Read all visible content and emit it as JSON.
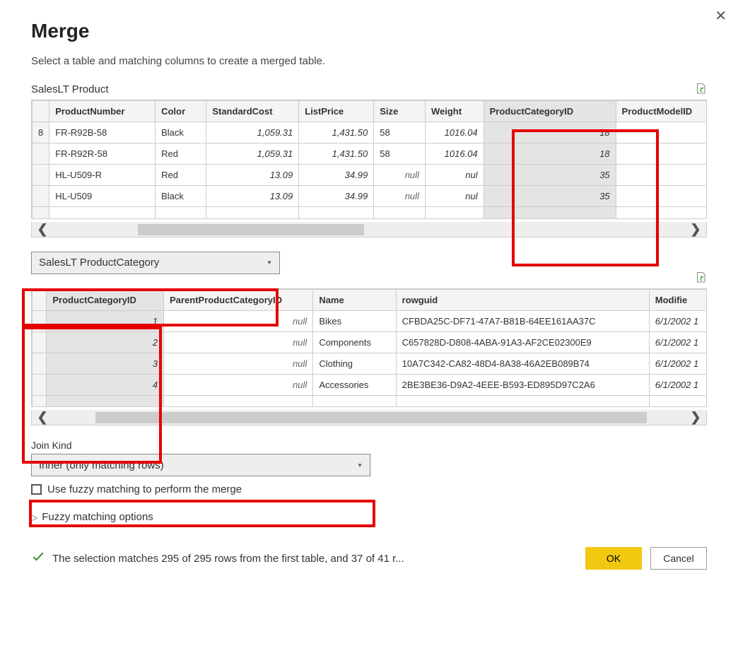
{
  "dialog": {
    "title": "Merge",
    "subtitle": "Select a table and matching columns to create a merged table."
  },
  "table1": {
    "name": "SalesLT Product",
    "columns": [
      "",
      "ProductNumber",
      "Color",
      "StandardCost",
      "ListPrice",
      "Size",
      "Weight",
      "ProductCategoryID",
      "ProductModelID"
    ],
    "rows": [
      {
        "idx": "8",
        "pn": "FR-R92B-58",
        "color": "Black",
        "sc": "1,059.31",
        "lp": "1,431.50",
        "size": "58",
        "w": "1016.04",
        "cat": "18",
        "pm": ""
      },
      {
        "idx": "",
        "pn": "FR-R92R-58",
        "color": "Red",
        "sc": "1,059.31",
        "lp": "1,431.50",
        "size": "58",
        "w": "1016.04",
        "cat": "18",
        "pm": ""
      },
      {
        "idx": "",
        "pn": "HL-U509-R",
        "color": "Red",
        "sc": "13.09",
        "lp": "34.99",
        "size": "null",
        "w": "nul",
        "cat": "35",
        "pm": ""
      },
      {
        "idx": "",
        "pn": "HL-U509",
        "color": "Black",
        "sc": "13.09",
        "lp": "34.99",
        "size": "null",
        "w": "nul",
        "cat": "35",
        "pm": ""
      }
    ]
  },
  "table2": {
    "selected": "SalesLT ProductCategory",
    "columns": [
      "",
      "ProductCategoryID",
      "ParentProductCategoryID",
      "Name",
      "rowguid",
      "Modifie"
    ],
    "rows": [
      {
        "idx": "",
        "id": "1",
        "parent": "null",
        "name": "Bikes",
        "guid": "CFBDA25C-DF71-47A7-B81B-64EE161AA37C",
        "mod": "6/1/2002 1"
      },
      {
        "idx": "",
        "id": "2",
        "parent": "null",
        "name": "Components",
        "guid": "C657828D-D808-4ABA-91A3-AF2CE02300E9",
        "mod": "6/1/2002 1"
      },
      {
        "idx": "",
        "id": "3",
        "parent": "null",
        "name": "Clothing",
        "guid": "10A7C342-CA82-48D4-8A38-46A2EB089B74",
        "mod": "6/1/2002 1"
      },
      {
        "idx": "",
        "id": "4",
        "parent": "null",
        "name": "Accessories",
        "guid": "2BE3BE36-D9A2-4EEE-B593-ED895D97C2A6",
        "mod": "6/1/2002 1"
      }
    ]
  },
  "joinKind": {
    "label": "Join Kind",
    "value": "Inner (only matching rows)"
  },
  "fuzzy": {
    "checkbox": "Use fuzzy matching to perform the merge",
    "options": "Fuzzy matching options"
  },
  "status": "The selection matches 295 of 295 rows from the first table, and 37 of 41 r...",
  "buttons": {
    "ok": "OK",
    "cancel": "Cancel"
  }
}
